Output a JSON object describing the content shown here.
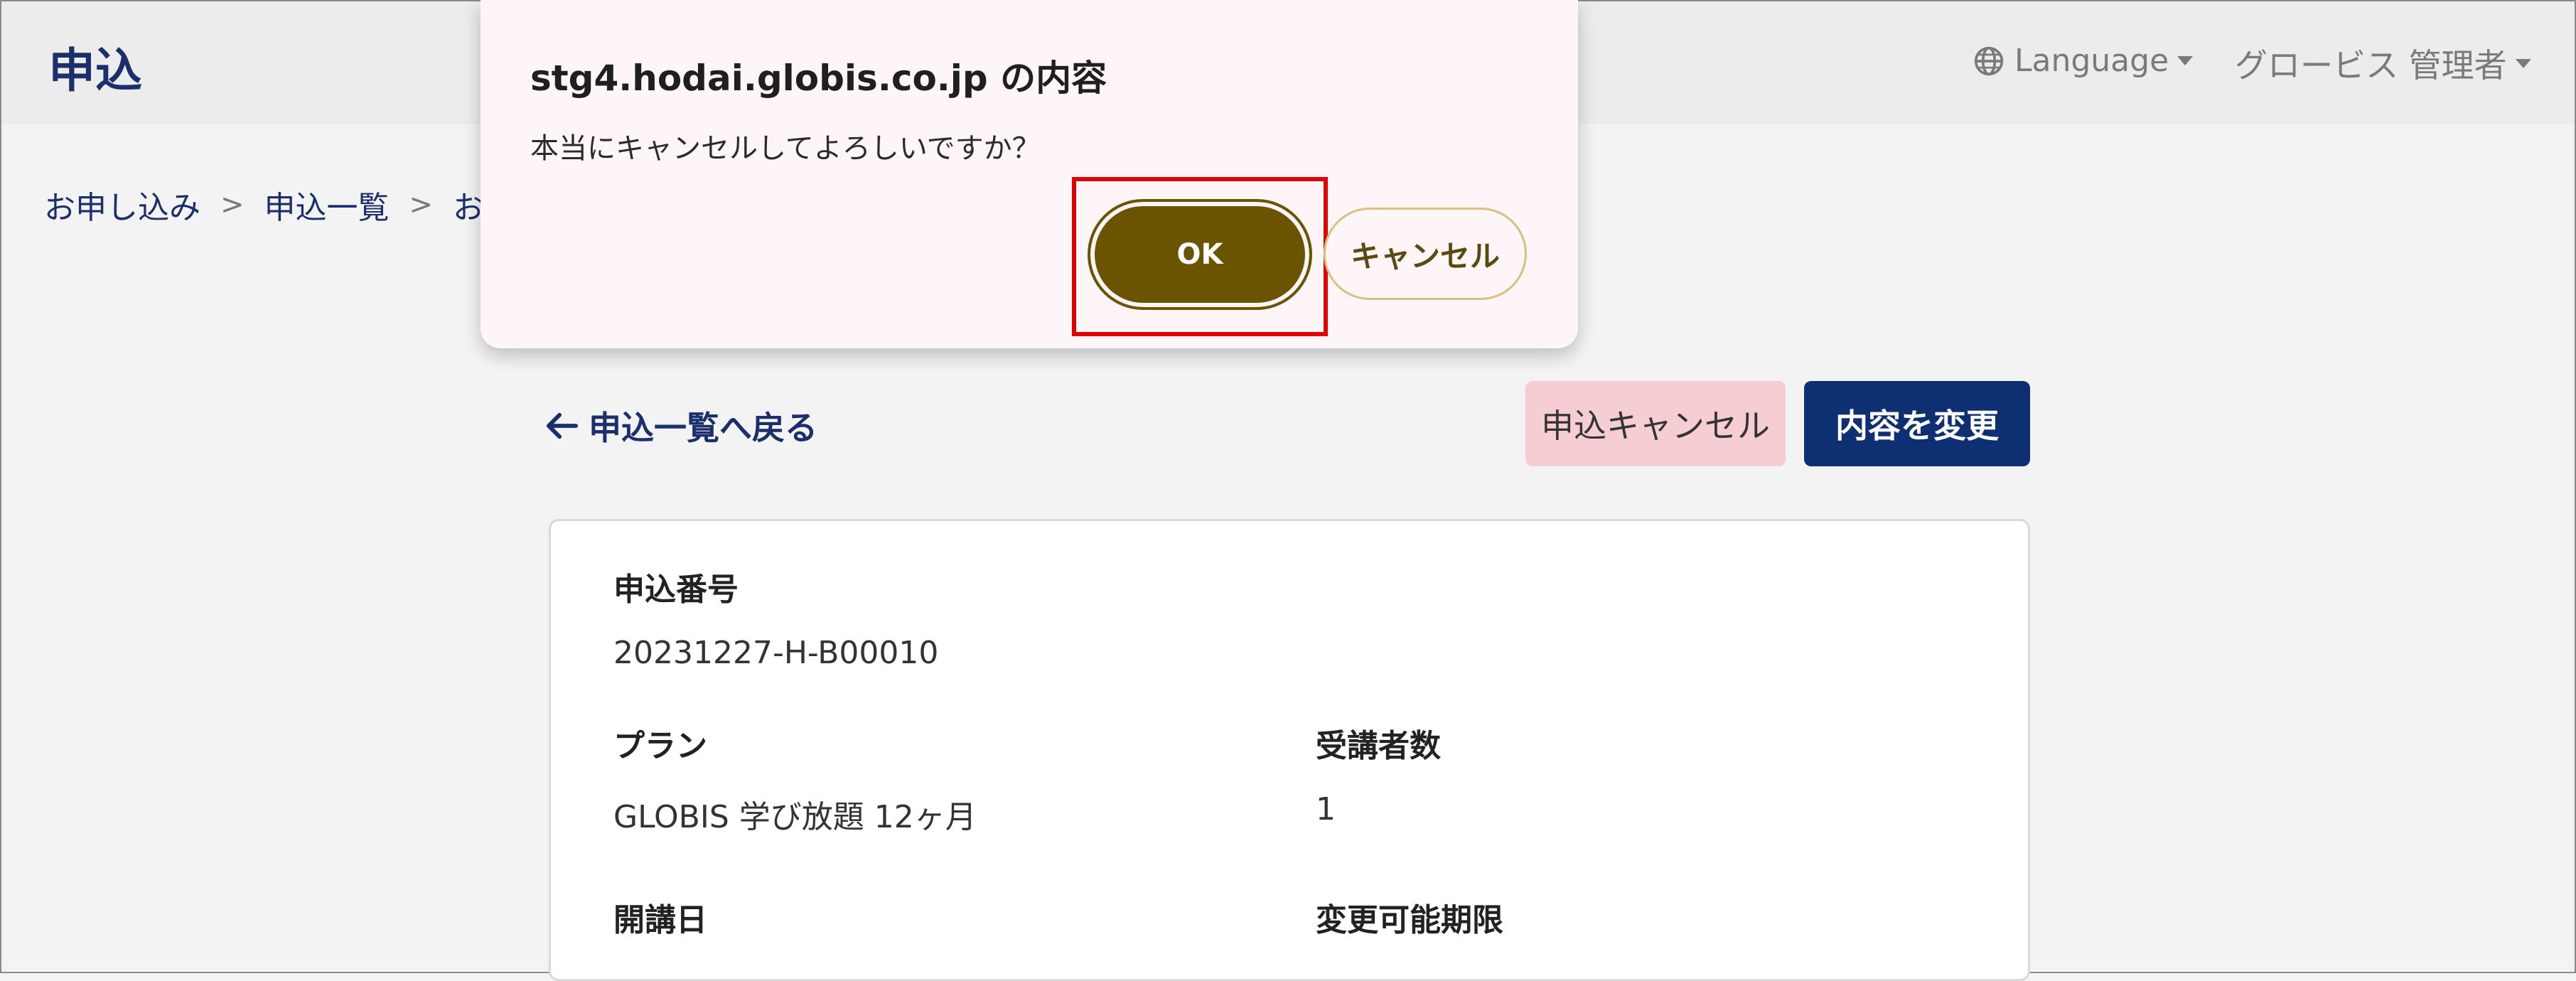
{
  "header": {
    "title": "申込",
    "language_label": "Language",
    "user_label": "グロービス 管理者"
  },
  "breadcrumb": [
    "お申し込み",
    "申込一覧",
    "お"
  ],
  "dialog": {
    "title": "stg4.hodai.globis.co.jp の内容",
    "message": "本当にキャンセルしてよろしいですか？",
    "ok_label": "OK",
    "cancel_label": "キャンセル"
  },
  "actions": {
    "back_label": "申込一覧へ戻る",
    "cancel_application_label": "申込キャンセル",
    "change_content_label": "内容を変更"
  },
  "details": {
    "application_number_label": "申込番号",
    "application_number": "20231227-H-B00010",
    "plan_label": "プラン",
    "plan": "GLOBIS 学び放題 12ヶ月",
    "participants_label": "受講者数",
    "participants": "1",
    "start_date_label": "開講日",
    "change_deadline_label": "変更可能期限"
  },
  "colors": {
    "brand_navy": "#0e2f72",
    "ok_button": "#6b5400",
    "cancel_pink": "#f5cdd2",
    "highlight_red": "#e00000"
  }
}
